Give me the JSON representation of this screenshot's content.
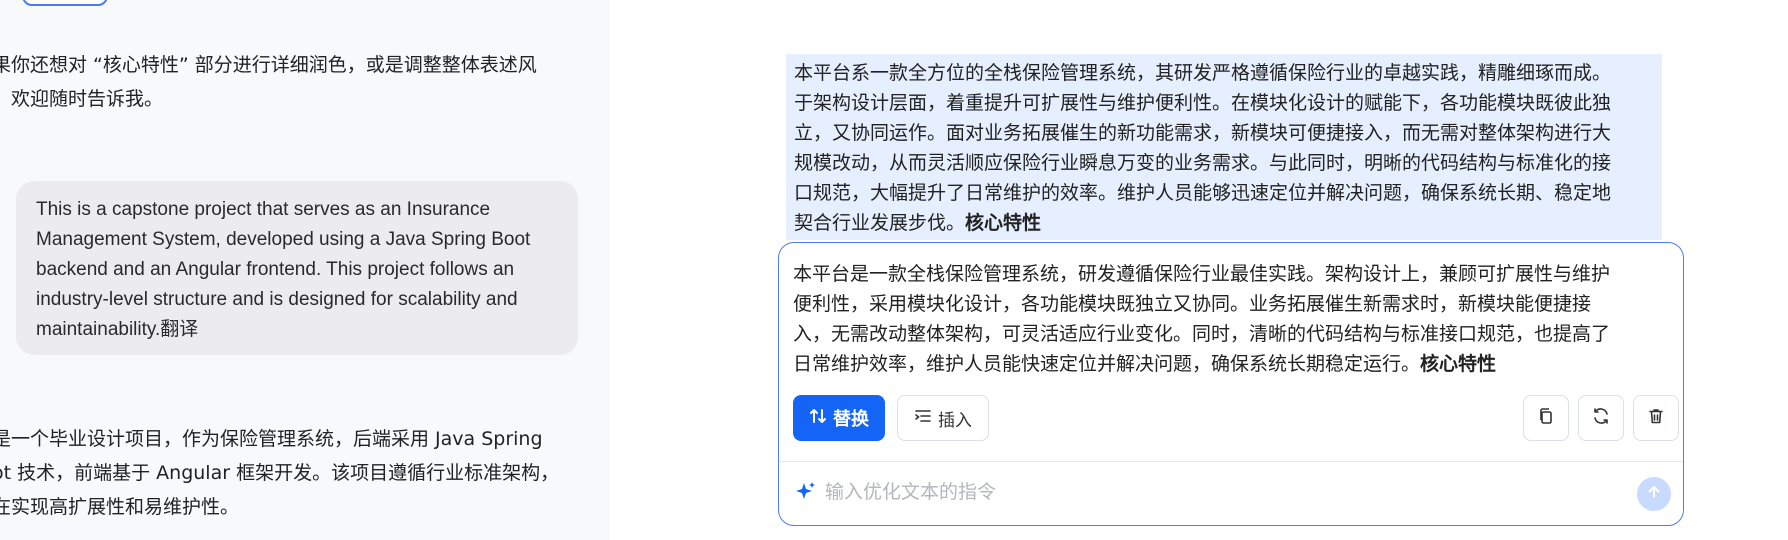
{
  "left_pane": {
    "paragraph_1": [
      "果你还想对 “核心特性” 部分进行详细润色，或是调整整体表述风",
      "，欢迎随时告诉我。"
    ],
    "user_message": [
      "This is a capstone project that serves as an Insurance",
      "Management System, developed using a Java Spring Boot",
      "backend and an Angular frontend. This project follows an",
      "industry-level structure and is designed for scalability and",
      "maintainability.翻译"
    ],
    "paragraph_2": [
      "是一个毕业设计项目，作为保险管理系统，后端采用 Java Spring",
      "ot 技术，前端基于 Angular 框架开发。该项目遵循行业标准架构，",
      "在实现高扩展性和易维护性。"
    ]
  },
  "source_text": {
    "lines": [
      "本平台系一款全方位的全栈保险管理系统，其研发严格遵循保险行业的卓越实践，精雕细琢而成。",
      "于架构设计层面，着重提升可扩展性与维护便利性。在模块化设计的赋能下，各功能模块既彼此独",
      "立，又协同运作。面对业务拓展催生的新功能需求，新模块可便捷接入，而无需对整体架构进行大",
      "规模改动，从而灵活顺应保险行业瞬息万变的业务需求。与此同时，明晰的代码结构与标准化的接",
      "口规范，大幅提升了日常维护的效率。维护人员能够迅速定位并解决问题，确保系统长期、稳定地"
    ],
    "last_line": "契合行业发展步伐。",
    "last_bold": "核心特性"
  },
  "edit_card": {
    "lines": [
      "本平台是一款全栈保险管理系统，研发遵循保险行业最佳实践。架构设计上，兼顾可扩展性与维护",
      "便利性，采用模块化设计，各功能模块既独立又协同。业务拓展催生新需求时，新模块能便捷接",
      "入，无需改动整体架构，可灵活适应行业变化。同时，清晰的代码结构与标准接口规范，也提高了"
    ],
    "last_line": "日常维护效率，维护人员能快速定位并解决问题，确保系统长期稳定运行。",
    "last_bold": "核心特性",
    "replace_label": "替换",
    "insert_label": "插入",
    "instruction_placeholder": "输入优化文本的指令"
  },
  "colors": {
    "accent": "#1464f5",
    "highlight": "#e6efff",
    "bubble": "#ececef"
  },
  "icons": [
    "swap-vertical-icon",
    "insert-list-icon",
    "copy-icon",
    "refresh-icon",
    "trash-icon",
    "sparkle-icon",
    "arrow-up-icon"
  ]
}
